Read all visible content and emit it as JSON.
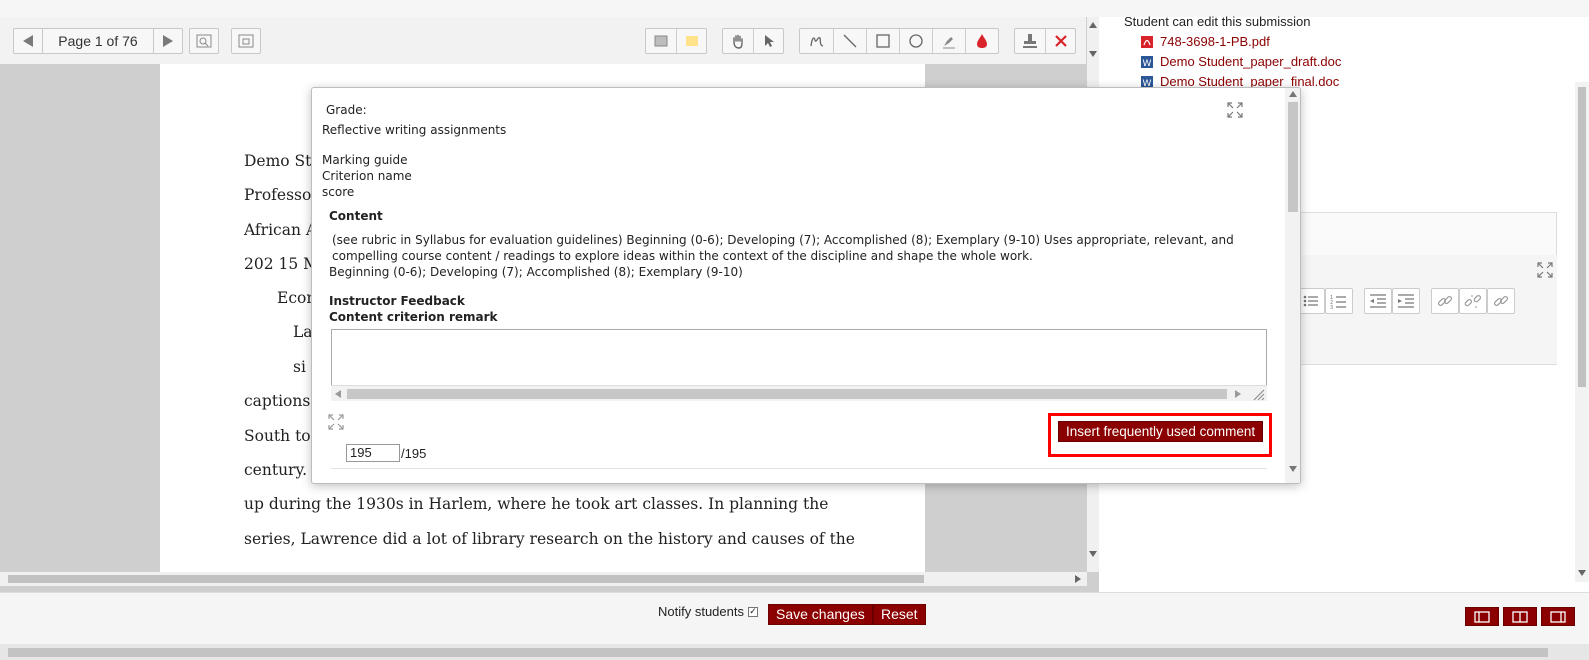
{
  "pdf_toolbar": {
    "page_label": "Page 1 of 76"
  },
  "document": {
    "lines": [
      "Demo St",
      "Professor",
      "African A",
      "202 15 M",
      "Econ",
      "La",
      "si",
      "captions)",
      "South to",
      "century. '",
      "up during the 1930s in Harlem, where he took art classes. In planning the",
      "series, Lawrence did a lot of library research on the history and causes of the"
    ]
  },
  "submission": {
    "edit_note": "Student can edit this submission",
    "files": [
      {
        "name": "748-3698-1-PB.pdf",
        "icon": "pdf-icon"
      },
      {
        "name": "Demo Student_paper_draft.doc",
        "icon": "word-icon"
      },
      {
        "name": "Demo Student_paper_final.doc",
        "icon": "word-icon"
      }
    ]
  },
  "modal": {
    "grade_label": "Grade:",
    "assignment_name": "Reflective writing assignments",
    "method_label": "Marking guide",
    "col_criterion": "Criterion name",
    "col_score": "score",
    "criterion_name": "Content",
    "criterion_description": "(see rubric in Syllabus for evaluation guidelines) Beginning (0-6); Developing (7); Accomplished (8); Exemplary (9-10) Uses appropriate, relevant, and compelling course content / readings to explore ideas within the context of the discipline and shape the whole work.",
    "criterion_levels": "Beginning (0-6); Developing (7); Accomplished (8); Exemplary (9-10)",
    "feedback_heading": "Instructor Feedback",
    "remark_label": "Content criterion remark",
    "remark_value": "",
    "insert_button": "Insert frequently used comment",
    "score_value": "195",
    "score_max": "/195"
  },
  "footer": {
    "notify_label": "Notify students",
    "notify_checked": true,
    "save_label": "Save changes",
    "reset_label": "Reset"
  },
  "colors": {
    "accent": "#8b0000",
    "highlight": "#ff0000"
  }
}
